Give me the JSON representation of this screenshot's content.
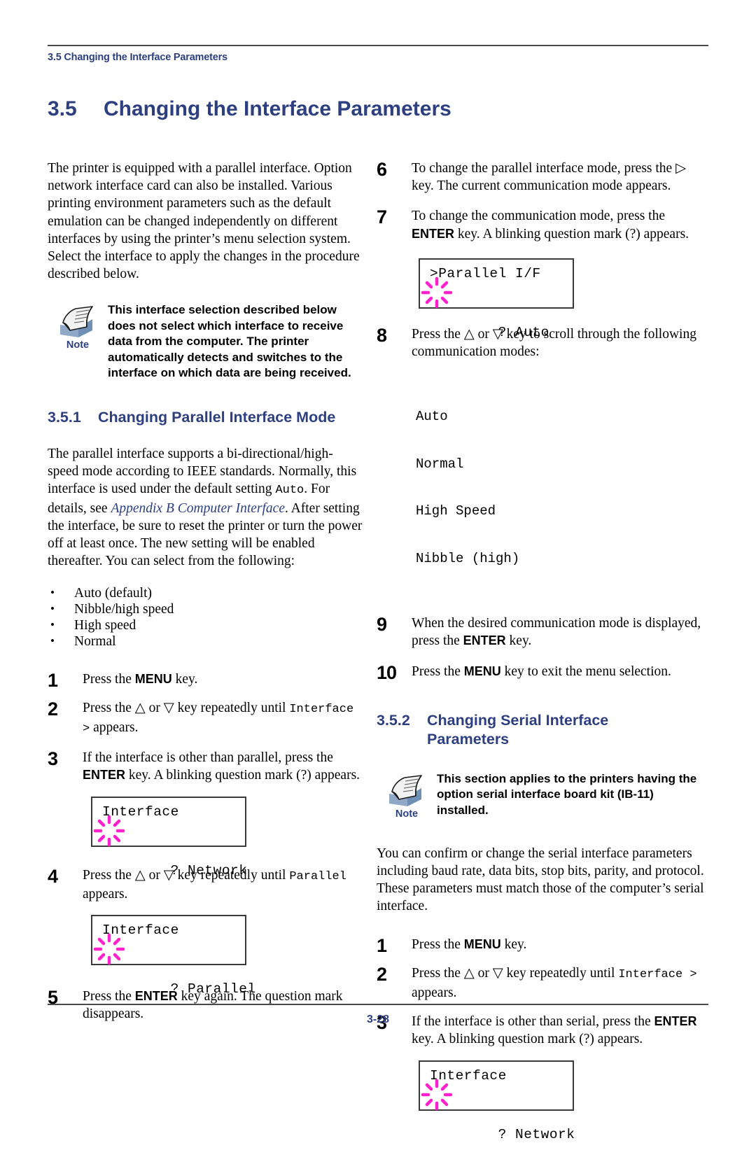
{
  "header": {
    "running_head": "3.5 Changing the Interface Parameters"
  },
  "title": {
    "number": "3.5",
    "text": "Changing the Interface Parameters"
  },
  "colors": {
    "heading_blue": "#2e3f7f",
    "blink_magenta": "#ff22cc",
    "rule_gray": "#4a4a4a"
  },
  "left_column": {
    "intro_paragraph": "The printer is equipped with a parallel interface. Option network interface card can also be installed. Various printing environment parameters such as the default emulation can be changed independently on different interfaces by using the printer’s menu selection system. Select the interface to apply the changes in the procedure described below.",
    "note": {
      "label": "Note",
      "icon": "note-document-icon",
      "text": "This interface selection described below does not select which interface to receive data from the computer. The printer automatically detects and switches to the interface on which data are being received."
    },
    "subsection": {
      "number": "3.5.1",
      "title": "Changing Parallel Interface Mode"
    },
    "para_1_a": "The parallel interface supports a bi-directional/high-speed mode according to IEEE standards. Normally, this interface is used under the default setting ",
    "para_1_mono": "Auto",
    "para_1_b": ". For details, see ",
    "para_1_link": "Appendix B Computer Interface",
    "para_1_c": ". After setting the interface, be sure to reset the printer or turn the power off at least once. The new setting will be enabled thereafter. You can select from the following:",
    "bullets": [
      "Auto (default)",
      "Nibble/high speed",
      "High speed",
      "Normal"
    ],
    "steps": [
      {
        "number": "1",
        "text_a": "Press the ",
        "key": "MENU",
        "text_b": " key."
      },
      {
        "number": "2",
        "text_a": "Press the △ or ▽ key repeatedly until ",
        "mono": "Interface >",
        "text_b": " appears."
      },
      {
        "number": "3",
        "text_a": "If the interface is other than parallel, press the ",
        "key": "ENTER",
        "text_b": " key. A blinking question mark (?) appears."
      },
      {
        "number": "4",
        "text_a": "Press the △ or ▽ key repeatedly until ",
        "mono": "Parallel",
        "text_b": " appears."
      },
      {
        "number": "5",
        "text_a": "Press the ",
        "key": "ENTER",
        "text_b": " key again. The question mark disappears."
      }
    ],
    "lcd_step3": {
      "line1": "Interface",
      "line2": "? Network"
    },
    "lcd_step4": {
      "line1": "Interface",
      "line2": "? Parallel"
    }
  },
  "right_column": {
    "steps_parallel": [
      {
        "number": "6",
        "text_a": "To change the parallel interface mode, press the ▷ key. The current communication mode appears."
      },
      {
        "number": "7",
        "text_a": "To change the communication mode, press the ",
        "key": "ENTER",
        "text_b": " key. A blinking question mark (?) appears."
      },
      {
        "number": "8",
        "text_a": "Press the △ or ▽ key to scroll through the following communication modes:"
      },
      {
        "number": "9",
        "text_a": "When the desired communication mode is displayed, press the ",
        "key": "ENTER",
        "text_b": " key."
      },
      {
        "number": "10",
        "text_a": "Press the ",
        "key": "MENU",
        "text_b": " key to exit the menu selection."
      }
    ],
    "lcd_step7": {
      "line1": ">Parallel I/F",
      "line2": "? Auto"
    },
    "communication_modes": [
      "Auto",
      "Normal",
      "High Speed",
      "Nibble (high)"
    ],
    "subsection": {
      "number": "3.5.2",
      "title_line1": "Changing Serial Interface",
      "title_line2": "Parameters"
    },
    "note": {
      "label": "Note",
      "icon": "note-document-icon",
      "text": "This section applies to the printers having the option serial interface board kit (IB-11) installed."
    },
    "para_serial": "You can confirm or change the serial interface parameters including baud rate, data bits, stop bits, parity, and protocol. These parameters must match those of the computer’s serial interface.",
    "steps_serial": [
      {
        "number": "1",
        "text_a": "Press the ",
        "key": "MENU",
        "text_b": " key."
      },
      {
        "number": "2",
        "text_a": "Press the △ or ▽ key repeatedly until ",
        "mono": "Interface >",
        "text_b": " appears."
      },
      {
        "number": "3",
        "text_a": "If the interface is other than serial, press the ",
        "key": "ENTER",
        "text_b": " key. A blinking question mark (?) appears."
      }
    ],
    "lcd_serial_step3": {
      "line1": "Interface",
      "line2": "? Network"
    }
  },
  "footer": {
    "page_number": "3-28"
  }
}
